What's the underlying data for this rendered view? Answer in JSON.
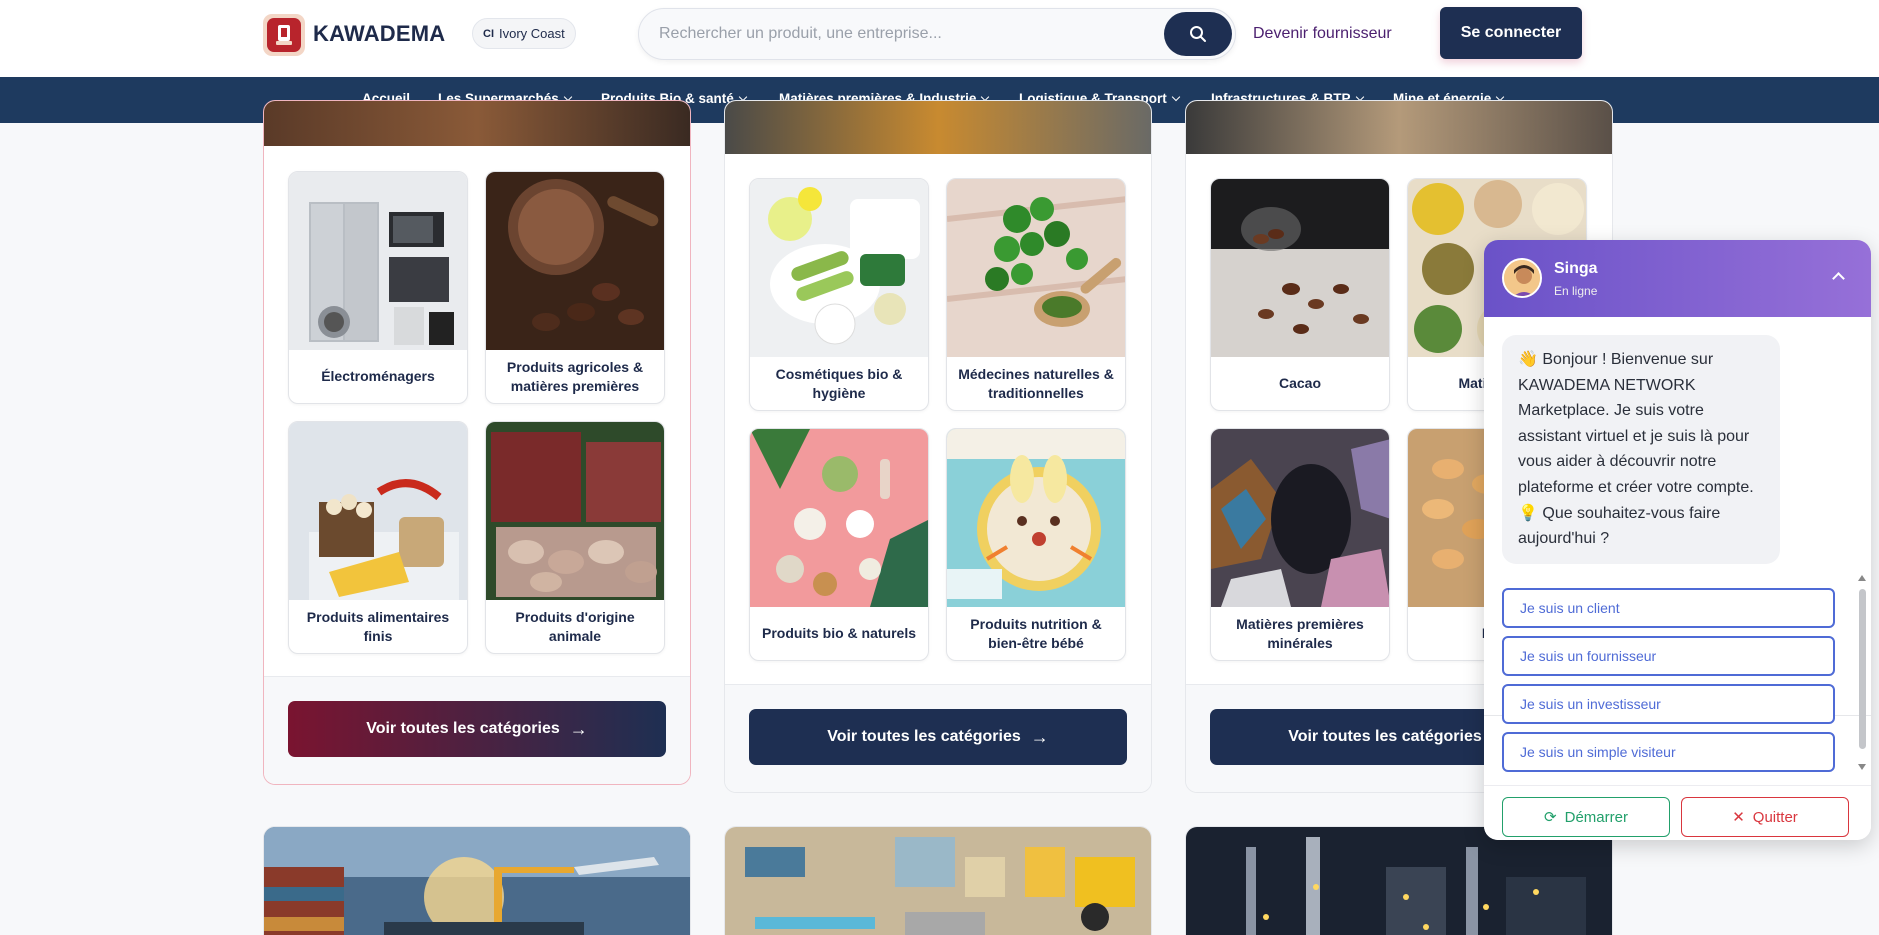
{
  "header": {
    "logo_text": "KAWADEMA",
    "country_code": "CI",
    "country_name": "Ivory Coast",
    "search_placeholder": "Rechercher un produit, une entreprise...",
    "become_supplier": "Devenir fournisseur",
    "login": "Se connecter"
  },
  "nav": {
    "items": [
      {
        "label": "Accueil"
      },
      {
        "label": "Les Supermarchés"
      },
      {
        "label": "Produits Bio & santé"
      },
      {
        "label": "Matières premières & Industrie"
      },
      {
        "label": "Logistique & Transport"
      },
      {
        "label": "Infrastructures & BTP"
      },
      {
        "label": "Mine et énergie"
      }
    ]
  },
  "cards": [
    {
      "tiles": [
        {
          "label": "Électroménagers"
        },
        {
          "label": "Produits agricoles & matières premières"
        },
        {
          "label": "Produits alimentaires finis"
        },
        {
          "label": "Produits d'origine animale"
        }
      ],
      "see_all": "Voir toutes les catégories"
    },
    {
      "tiles": [
        {
          "label": "Cosmétiques bio & hygiène"
        },
        {
          "label": "Médecines naturelles & traditionnelles"
        },
        {
          "label": "Produits bio & naturels"
        },
        {
          "label": "Produits nutrition & bien-être bébé"
        }
      ],
      "see_all": "Voir toutes les catégories"
    },
    {
      "tiles": [
        {
          "label": "Cacao"
        },
        {
          "label": "Matières ag"
        },
        {
          "label": "Matières premières minérales"
        },
        {
          "label": "Noix"
        }
      ],
      "see_all": "Voir toutes les catégories"
    }
  ],
  "chat": {
    "agent_name": "Singa",
    "status": "En ligne",
    "greeting": "👋 Bonjour ! Bienvenue sur KAWADEMA NETWORK Marketplace. Je suis votre assistant virtuel et je suis là pour vous aider à découvrir notre plateforme et créer votre compte. 💡 Que souhaitez-vous faire aujourd'hui ?",
    "options": [
      {
        "label": "Je suis un client"
      },
      {
        "label": "Je suis un fournisseur"
      },
      {
        "label": "Je suis un investisseur"
      },
      {
        "label": "Je suis un simple visiteur"
      }
    ],
    "start_label": "Démarrer",
    "quit_label": "Quitter"
  },
  "colors": {
    "navy": "#1e2f52",
    "nav_bar": "#1e3a5f",
    "maroon": "#7a1430",
    "chat_purple": "#7b5fd0",
    "option_blue": "#4f6bd6",
    "start_green": "#22a06b",
    "quit_red": "#d9363e"
  }
}
